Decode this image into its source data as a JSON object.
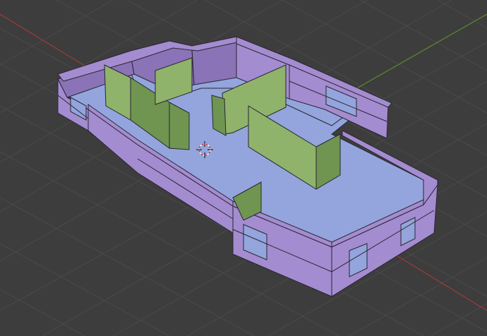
{
  "viewport": {
    "background": "#3d3d3d",
    "grid_color": "#4a4a4a",
    "x_axis_color": "#a03a3a",
    "y_axis_color": "#5a8a2a"
  },
  "model": {
    "wall_color": "#a48cd0",
    "wall_dark_color": "#8a73b6",
    "floor_color": "#93a5dc",
    "partition_color": "#8fb36a",
    "partition_dark_color": "#6f9550",
    "edge_color": "#2a2533"
  },
  "origin_marker": {
    "icon": "3d-cursor-icon"
  }
}
